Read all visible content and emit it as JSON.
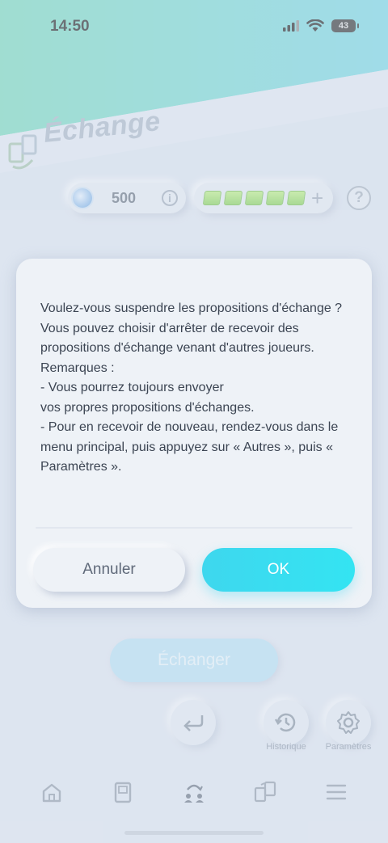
{
  "status_bar": {
    "time": "14:50",
    "battery": "43"
  },
  "header": {
    "title": "Échange"
  },
  "currency": {
    "coins": "500",
    "hourglass_count": 5
  },
  "dialog": {
    "message": "Voulez-vous suspendre les propositions d'échange ?\nVous pouvez choisir d'arrêter de recevoir des propositions d'échange venant d'autres joueurs.\nRemarques :\n- Vous pourrez toujours envoyer\nvos propres propositions d'échanges.\n-  Pour en recevoir de nouveau, rendez-vous dans le menu principal, puis appuyez sur « Autres », puis « Paramètres ».",
    "cancel_label": "Annuler",
    "ok_label": "OK"
  },
  "main": {
    "exchange_button": "Échanger",
    "history_label": "Historique",
    "settings_label": "Paramètres"
  },
  "colors": {
    "accent": "#3ed7ee",
    "header_teal": "#6fd8cf"
  },
  "icons": [
    "signal-icon",
    "wifi-icon",
    "battery-icon",
    "exchange-logo-icon",
    "coin-icon",
    "info-icon",
    "hourglass-icon",
    "plus-icon",
    "help-icon",
    "back-icon",
    "history-icon",
    "gear-icon",
    "home-icon",
    "cards-icon",
    "exchange-tab-icon",
    "trade-tab-icon",
    "menu-icon"
  ]
}
